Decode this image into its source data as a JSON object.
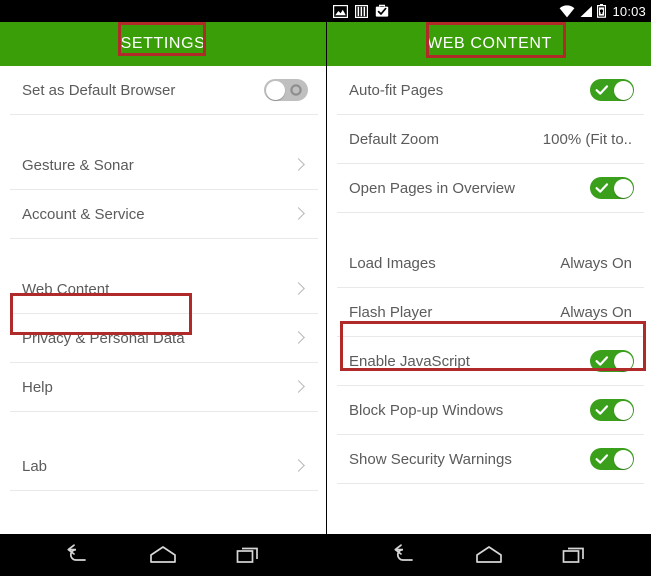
{
  "colors": {
    "action_bar_green": "#3a9e09",
    "toggle_on_green": "#3aa01c",
    "toggle_off_gray": "#bfbfbf",
    "annotation_red": "#b02a2a",
    "status_bar_black": "#000000",
    "label_gray": "#5b5b5b"
  },
  "left_panel": {
    "status_bar": {
      "icons": []
    },
    "header": {
      "title": "SETTINGS"
    },
    "sections": [
      {
        "rows": [
          {
            "label": "Set as Default Browser",
            "control": "toggle",
            "toggle_state": "off"
          }
        ]
      },
      {
        "rows": [
          {
            "label": "Gesture & Sonar",
            "control": "chevron"
          },
          {
            "label": "Account & Service",
            "control": "chevron"
          }
        ]
      },
      {
        "rows": [
          {
            "label": "Web Content",
            "control": "chevron",
            "highlighted": true
          },
          {
            "label": "Privacy & Personal Data",
            "control": "chevron"
          },
          {
            "label": "Help",
            "control": "chevron"
          }
        ]
      },
      {
        "rows": [
          {
            "label": "Lab",
            "control": "chevron"
          }
        ]
      }
    ],
    "nav_bar": {
      "back": "back-icon",
      "home": "home-icon",
      "recents": "recents-icon"
    }
  },
  "right_panel": {
    "status_bar": {
      "left_icons": [
        "image-icon",
        "sim-card-icon",
        "briefcase-check-icon"
      ],
      "right_icons": [
        "wifi-icon",
        "signal-icon",
        "battery-icon"
      ],
      "time": "10:03"
    },
    "header": {
      "title": "WEB CONTENT"
    },
    "sections": [
      {
        "rows": [
          {
            "label": "Auto-fit Pages",
            "control": "toggle",
            "toggle_state": "on"
          },
          {
            "label": "Default Zoom",
            "control": "value",
            "value": "100% (Fit to.."
          },
          {
            "label": "Open Pages in Overview",
            "control": "toggle",
            "toggle_state": "on"
          }
        ]
      },
      {
        "rows": [
          {
            "label": "Load Images",
            "control": "value",
            "value": "Always On"
          },
          {
            "label": "Flash Player",
            "control": "value",
            "value": "Always On",
            "highlighted": true
          },
          {
            "label": "Enable JavaScript",
            "control": "toggle",
            "toggle_state": "on"
          },
          {
            "label": "Block Pop-up Windows",
            "control": "toggle",
            "toggle_state": "on"
          },
          {
            "label": "Show Security Warnings",
            "control": "toggle",
            "toggle_state": "on"
          }
        ]
      }
    ],
    "nav_bar": {
      "back": "back-icon",
      "home": "home-icon",
      "recents": "recents-icon"
    }
  }
}
